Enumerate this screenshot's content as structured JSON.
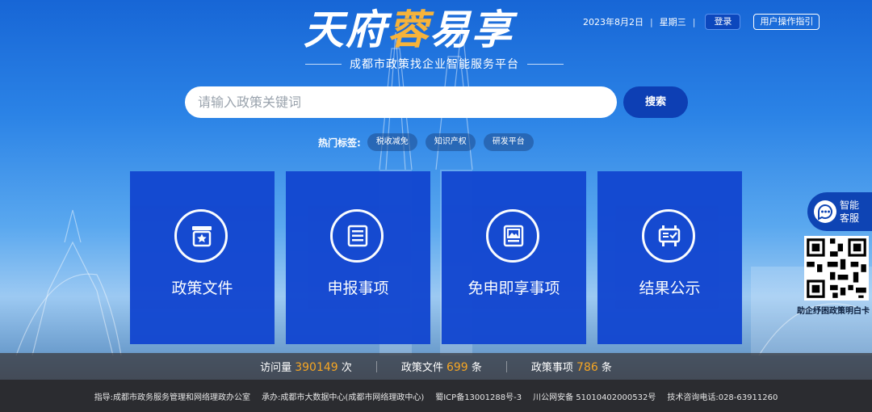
{
  "header": {
    "logo_part1": "天府",
    "logo_part2": "蓉",
    "logo_part3": "易享",
    "slogan": "成都市政策找企业智能服务平台",
    "date": "2023年8月2日",
    "weekday": "星期三",
    "login_label": "登录",
    "guide_label": "用户操作指引"
  },
  "search": {
    "placeholder": "请输入政策关键词",
    "button_label": "搜索",
    "hot_label": "热门标签:",
    "hot_tags": [
      "税收减免",
      "知识产权",
      "研发平台"
    ]
  },
  "cards": [
    {
      "title": "政策文件",
      "icon": "policy-badge-icon"
    },
    {
      "title": "申报事项",
      "icon": "document-list-icon"
    },
    {
      "title": "免申即享事项",
      "icon": "image-document-icon"
    },
    {
      "title": "结果公示",
      "icon": "notice-board-icon"
    }
  ],
  "float": {
    "service_label": "智能客服",
    "qr_caption": "助企纾困政策明白卡"
  },
  "stats": {
    "visits_label": "访问量",
    "visits_value": "390149",
    "visits_unit": "次",
    "files_label": "政策文件",
    "files_value": "699",
    "files_unit": "条",
    "items_label": "政策事项",
    "items_value": "786",
    "items_unit": "条"
  },
  "footer": {
    "guide": "指导:成都市政务服务管理和网络理政办公室",
    "undertake": "承办:成都市大数据中心(成都市网络理政中心)",
    "icp": "蜀ICP备13001288号-3",
    "police": "川公网安备 51010402000532号",
    "phone": "技术咨询电话:028-63911260"
  },
  "colors": {
    "card_blue": "#1347d0",
    "accent_orange": "#f6a623",
    "logo_gold": "#f7b33a"
  }
}
